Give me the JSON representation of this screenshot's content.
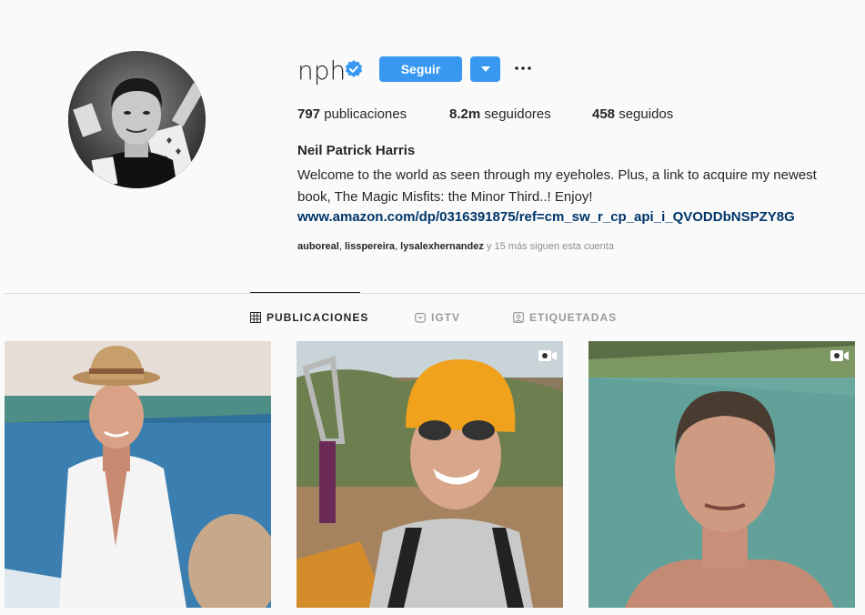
{
  "profile": {
    "username": "nph",
    "follow_label": "Seguir",
    "stats": {
      "posts_count": "797",
      "posts_label": "publicaciones",
      "followers_count": "8.2m",
      "followers_label": "seguidores",
      "following_count": "458",
      "following_label": "seguidos"
    },
    "full_name": "Neil Patrick Harris",
    "bio": "Welcome to the world as seen through my eyeholes. Plus, a link to acquire my newest book, The Magic Misfits: the Minor Third..! Enjoy!",
    "link": "www.amazon.com/dp/0316391875/ref=cm_sw_r_cp_api_i_QVODDbNSPZY8G",
    "followed_by": {
      "user1": "auboreal",
      "user2": "lisspereira",
      "user3": "lysalexhernandez",
      "more": "y 15 más siguen esta cuenta",
      "sep": ", "
    }
  },
  "tabs": [
    {
      "label": "PUBLICACIONES",
      "icon": "grid-icon",
      "active": true
    },
    {
      "label": "IGTV",
      "icon": "igtv-icon",
      "active": false
    },
    {
      "label": "ETIQUETADAS",
      "icon": "tagged-icon",
      "active": false
    }
  ],
  "posts": [
    {
      "description": "man in hat on boat",
      "video": false
    },
    {
      "description": "man with helmet ziplining selfie",
      "video": true
    },
    {
      "description": "man in pool selfie",
      "video": true
    }
  ],
  "colors": {
    "accent": "#3897f0",
    "link": "#003569",
    "background": "#fafafa"
  }
}
